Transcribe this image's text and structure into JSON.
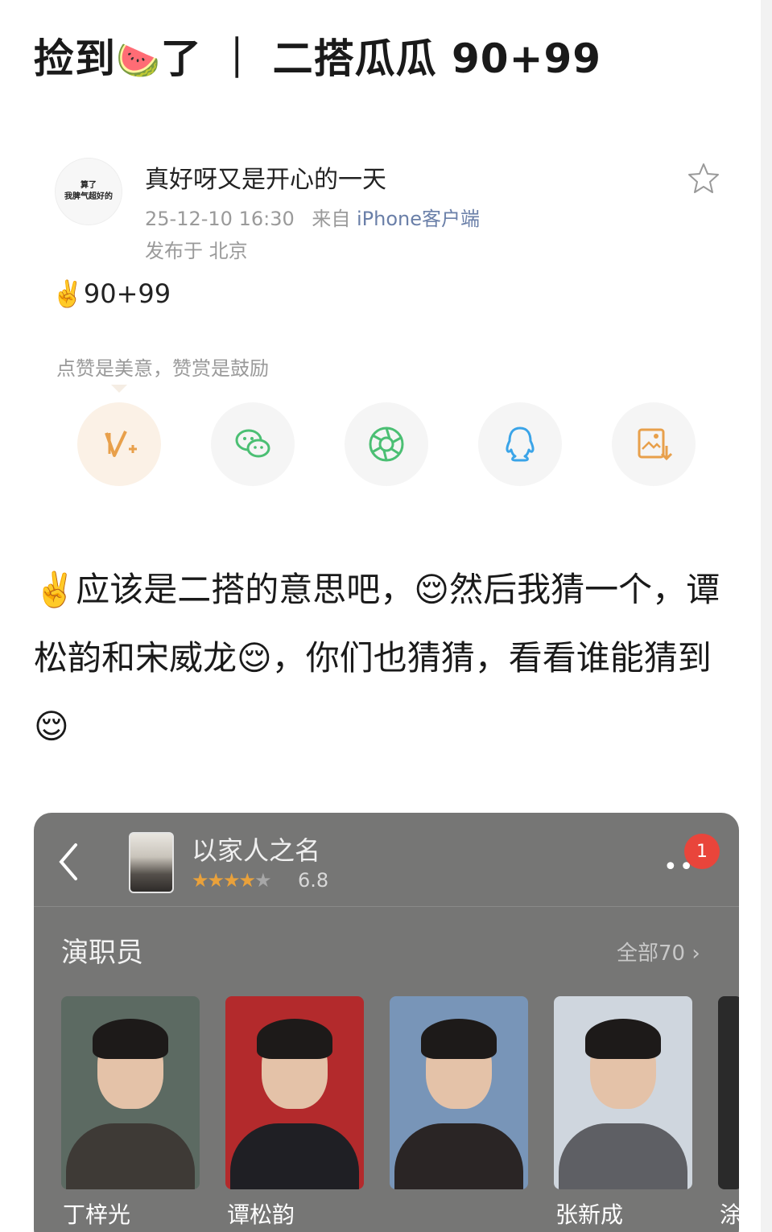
{
  "title": {
    "prefix": "捡到",
    "emoji": "🍉",
    "suffix": "了 ｜ 二搭瓜瓜 90+99"
  },
  "post": {
    "avatar_lines": [
      "算了",
      "我脾气超好的"
    ],
    "username": "真好呀又是开心的一天",
    "timestamp": "25-12-10 16:30",
    "source_prefix": "来自",
    "source": "iPhone客户端",
    "location": "发布于 北京",
    "short_text": "✌️90+99",
    "appreciate_hint": "点赞是美意，赞赏是鼓励",
    "share_actions": [
      {
        "name": "reward",
        "icon": "reward-v-plus-icon",
        "color": "#e8a04b"
      },
      {
        "name": "wechat",
        "icon": "wechat-icon",
        "color": "#4bbf73"
      },
      {
        "name": "moments",
        "icon": "moments-aperture-icon",
        "color": "#4bbf73"
      },
      {
        "name": "qq",
        "icon": "qq-penguin-icon",
        "color": "#3aa4e8"
      },
      {
        "name": "save-image",
        "icon": "save-image-icon",
        "color": "#e8a04b"
      }
    ],
    "body_text": "✌️应该是二搭的意思吧，😌然后我猜一个，谭松韵和宋威龙😌，你们也猜猜，看看谁能猜到😌"
  },
  "embedded_screenshot": {
    "drama_title": "以家人之名",
    "rating": "6.8",
    "rating_stars": {
      "filled": 3,
      "half": 1,
      "empty": 1
    },
    "notification_count": "1",
    "section_title": "演职员",
    "view_all": "全部70 ›",
    "cast": [
      {
        "name": "丁梓光",
        "bg": "#5c6a62",
        "cloth": "#3e3a36"
      },
      {
        "name": "谭松韵",
        "bg": "#b32a2c",
        "cloth": "#1f1f24"
      },
      {
        "name": "",
        "bg": "#7895b8",
        "cloth": "#2a2525"
      },
      {
        "name": "张新成",
        "bg": "#cfd6de",
        "cloth": "#5e5f64"
      },
      {
        "name": "涂",
        "bg": "#2a2a2a",
        "cloth": "#2a2a2a"
      }
    ]
  }
}
